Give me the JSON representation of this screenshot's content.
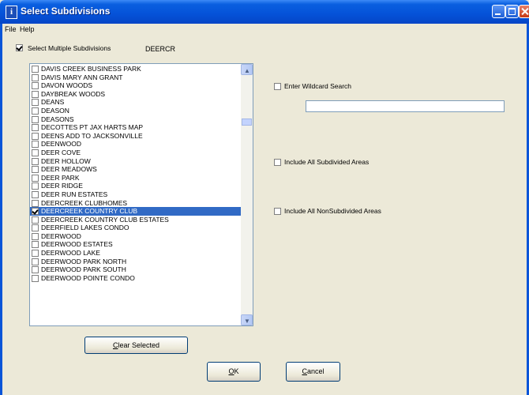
{
  "window": {
    "title": "Select Subdivisions",
    "icon_glyph": "i"
  },
  "menu": [
    "File",
    "Help"
  ],
  "select_multiple": {
    "label": "Select Multiple Subdivisions",
    "checked": true,
    "current_selection": "DEERCR"
  },
  "list": {
    "items": [
      {
        "label": "DAVIS CREEK BUSINESS PARK",
        "checked": false,
        "selected": false
      },
      {
        "label": "DAVIS MARY ANN GRANT",
        "checked": false,
        "selected": false
      },
      {
        "label": "DAVON WOODS",
        "checked": false,
        "selected": false
      },
      {
        "label": "DAYBREAK WOODS",
        "checked": false,
        "selected": false
      },
      {
        "label": "DEANS",
        "checked": false,
        "selected": false
      },
      {
        "label": "DEASON",
        "checked": false,
        "selected": false
      },
      {
        "label": "DEASONS",
        "checked": false,
        "selected": false
      },
      {
        "label": "DECOTTES PT JAX HARTS MAP",
        "checked": false,
        "selected": false
      },
      {
        "label": "DEENS ADD TO JACKSONVILLE",
        "checked": false,
        "selected": false
      },
      {
        "label": "DEENWOOD",
        "checked": false,
        "selected": false
      },
      {
        "label": "DEER COVE",
        "checked": false,
        "selected": false
      },
      {
        "label": "DEER HOLLOW",
        "checked": false,
        "selected": false
      },
      {
        "label": "DEER MEADOWS",
        "checked": false,
        "selected": false
      },
      {
        "label": "DEER PARK",
        "checked": false,
        "selected": false
      },
      {
        "label": "DEER RIDGE",
        "checked": false,
        "selected": false
      },
      {
        "label": "DEER RUN ESTATES",
        "checked": false,
        "selected": false
      },
      {
        "label": "DEERCREEK CLUBHOMES",
        "checked": false,
        "selected": false
      },
      {
        "label": "DEERCREEK COUNTRY CLUB",
        "checked": true,
        "selected": true
      },
      {
        "label": "DEERCREEK COUNTRY CLUB ESTATES",
        "checked": false,
        "selected": false
      },
      {
        "label": "DEERFIELD LAKES CONDO",
        "checked": false,
        "selected": false
      },
      {
        "label": "DEERWOOD",
        "checked": false,
        "selected": false
      },
      {
        "label": "DEERWOOD ESTATES",
        "checked": false,
        "selected": false
      },
      {
        "label": "DEERWOOD LAKE",
        "checked": false,
        "selected": false
      },
      {
        "label": "DEERWOOD PARK NORTH",
        "checked": false,
        "selected": false
      },
      {
        "label": "DEERWOOD PARK SOUTH",
        "checked": false,
        "selected": false
      },
      {
        "label": "DEERWOOD POINTE CONDO",
        "checked": false,
        "selected": false
      }
    ]
  },
  "options": {
    "wildcard": {
      "label": "Enter Wildcard Search",
      "checked": false,
      "value": ""
    },
    "subdivided": {
      "label": "Include All Subdivided Areas",
      "checked": false
    },
    "nonsubdivided": {
      "label": "Include All NonSubdivided Areas",
      "checked": false
    }
  },
  "buttons": {
    "clear": {
      "prefix": "C",
      "rest": "lear Selected"
    },
    "ok": {
      "prefix": "O",
      "rest": "K"
    },
    "cancel": {
      "prefix": "C",
      "rest": "ancel"
    }
  },
  "colors": {
    "title_bar": "#0552D8",
    "selection": "#316AC5",
    "window_bg": "#ECE9D8"
  }
}
